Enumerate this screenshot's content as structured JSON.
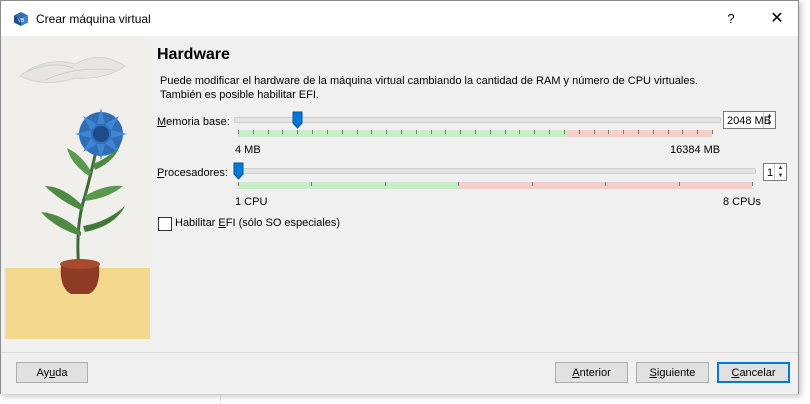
{
  "window": {
    "title": "Crear máquina virtual",
    "help_label": "?",
    "close_label": "✕"
  },
  "page": {
    "heading": "Hardware",
    "description_line1": "Puede modificar el hardware de la máquina virtual cambiando la cantidad de RAM y número de CPU virtuales.",
    "description_line2": "También es posible habilitar EFI."
  },
  "memory": {
    "label_prefix": "M",
    "label_rest": "emoria base:",
    "value": "2048 MB",
    "min_label": "4 MB",
    "max_label": "16384 MB",
    "level_fraction": 0.125
  },
  "processors": {
    "label_prefix": "P",
    "label_rest": "rocesadores:",
    "value": "1",
    "min_label": "1 CPU",
    "max_label": "8 CPUs",
    "level_fraction": 0.0
  },
  "efi": {
    "label_before": "Habilitar ",
    "label_underlined": "E",
    "label_after": "FI (sólo SO especiales)",
    "checked": false
  },
  "footer": {
    "help_prefix": "Ay",
    "help_u": "u",
    "help_rest": "da",
    "back_prefix": "",
    "back_u": "A",
    "back_rest": "nterior",
    "next_prefix": "",
    "next_u": "S",
    "next_rest": "iguiente",
    "cancel_prefix": "",
    "cancel_u": "C",
    "cancel_rest": "ancelar"
  },
  "colors": {
    "accent": "#0078d7",
    "green_zone": "#c6efc6",
    "red_zone": "#f6cfc8"
  },
  "icons": [
    "virtualbox-cube-icon",
    "help-icon",
    "close-icon",
    "slider-thumb-icon",
    "spin-up-icon",
    "spin-down-icon",
    "checkbox-icon",
    "plant-illustration"
  ]
}
